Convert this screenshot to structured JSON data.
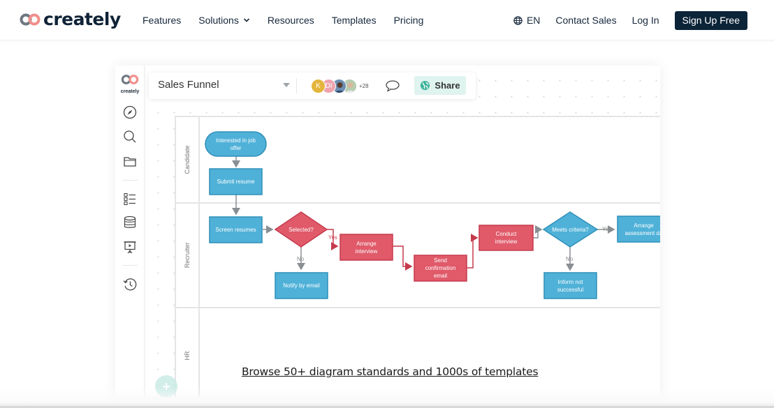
{
  "nav": {
    "brand": "creately",
    "links": [
      {
        "label": "Features"
      },
      {
        "label": "Solutions",
        "has_dropdown": true
      },
      {
        "label": "Resources"
      },
      {
        "label": "Templates"
      },
      {
        "label": "Pricing"
      }
    ],
    "language": "EN",
    "contact_sales": "Contact Sales",
    "login": "Log In",
    "signup": "Sign Up Free",
    "colors": {
      "text": "#15273a",
      "signup_bg": "#0c2438"
    }
  },
  "app": {
    "rail_logo_text": "creately",
    "rail_icons": [
      "compass-icon",
      "search-icon",
      "folder-icon",
      "checklist-icon",
      "database-icon",
      "presentation-icon",
      "history-icon"
    ],
    "document_title": "Sales Funnel",
    "collaborators": [
      {
        "initial": "K",
        "color": "#e4b53c"
      },
      {
        "initial": "DI",
        "color": "#eea3ae"
      },
      {
        "initial": "",
        "color": "#5a7fa8"
      },
      {
        "initial": "",
        "color": "#a8c7a8"
      }
    ],
    "collaborators_more": "+28",
    "share_label": "Share",
    "colors": {
      "share_bg": "#dff3ef",
      "blue_node": "#4fb1d8",
      "red_node": "#e05a6a"
    }
  },
  "diagram": {
    "lanes": [
      {
        "label": "Candidate"
      },
      {
        "label": "Recruiter"
      },
      {
        "label": "HR"
      }
    ],
    "nodes": {
      "interested": "Interested in job offer",
      "submit": "Submit resume",
      "screen": "Screen resumes",
      "selected": "Selected?",
      "notify": "Notify by email",
      "arrange_interview": "Arrange interview",
      "send_confirmation": "Send confirmation email",
      "conduct": "Conduct interview",
      "meets": "Meets criteria?",
      "inform": "Inform not successful",
      "assessment": "Arrange assessment da"
    },
    "edge_labels": {
      "selected_yes": "Yes",
      "selected_no": "No",
      "meets_yes": "Yes",
      "meets_no": "No"
    }
  },
  "cta": {
    "browse_link": "Browse 50+ diagram standards and 1000s of templates"
  }
}
